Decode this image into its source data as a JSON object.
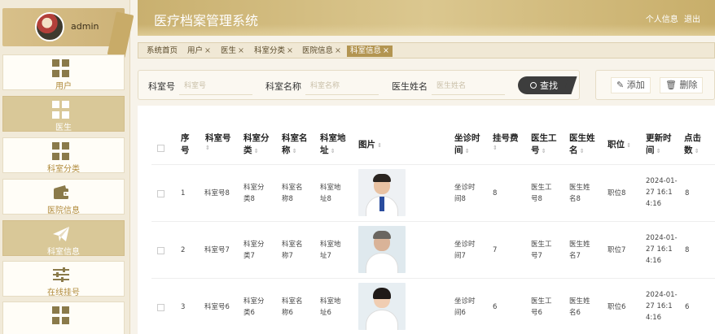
{
  "user": {
    "name": "admin"
  },
  "sidebar": {
    "items": [
      {
        "label": "用户",
        "icon": "grid-icon"
      },
      {
        "label": "医生",
        "icon": "grid-icon"
      },
      {
        "label": "科室分类",
        "icon": "grid-icon"
      },
      {
        "label": "医院信息",
        "icon": "wallet-icon"
      },
      {
        "label": "科室信息",
        "icon": "paper-plane-icon"
      },
      {
        "label": "在线挂号",
        "icon": "sliders-icon"
      },
      {
        "label": "",
        "icon": "grid-icon"
      }
    ]
  },
  "header": {
    "title": "医疗档案管理系统",
    "profile_link": "个人信息",
    "logout_link": "退出"
  },
  "tabs": [
    {
      "label": "系统首页",
      "closable": false
    },
    {
      "label": "用户",
      "closable": true
    },
    {
      "label": "医生",
      "closable": true
    },
    {
      "label": "科室分类",
      "closable": true
    },
    {
      "label": "医院信息",
      "closable": true
    },
    {
      "label": "科室信息",
      "closable": true,
      "active": true
    }
  ],
  "search": {
    "dept_no_label": "科室号",
    "dept_no_placeholder": "科室号",
    "dept_name_label": "科室名称",
    "dept_name_placeholder": "科室名称",
    "doctor_name_label": "医生姓名",
    "doctor_name_placeholder": "医生姓名",
    "button": "查找"
  },
  "actions": {
    "add": "添加",
    "delete": "删除"
  },
  "table": {
    "headers": {
      "index": [
        "序",
        "号"
      ],
      "dept_no": [
        "科室号"
      ],
      "category": [
        "科室分",
        "类"
      ],
      "dept_name": [
        "科室名",
        "称"
      ],
      "address": [
        "科室地",
        "址"
      ],
      "image": [
        "图片"
      ],
      "sit_time": [
        "坐诊时",
        "间"
      ],
      "fee": [
        "挂号费"
      ],
      "doctor_no": [
        "医生工",
        "号"
      ],
      "doctor_name": [
        "医生姓",
        "名"
      ],
      "position": [
        "职位"
      ],
      "updated": [
        "更新时",
        "间"
      ],
      "clicks": [
        "点击",
        "数"
      ]
    },
    "rows": [
      {
        "index": "1",
        "dept_no": "科室号8",
        "category": [
          "科室分",
          "类8"
        ],
        "dept_name": [
          "科室名",
          "称8"
        ],
        "address": [
          "科室地",
          "址8"
        ],
        "sit_time": [
          "坐诊时",
          "间8"
        ],
        "fee": "8",
        "doctor_no": [
          "医生工",
          "号8"
        ],
        "doctor_name": [
          "医生姓",
          "名8"
        ],
        "position": "职位8",
        "updated": [
          "2024-01-",
          "27 16:1",
          "4:16"
        ],
        "clicks": "8"
      },
      {
        "index": "2",
        "dept_no": "科室号7",
        "category": [
          "科室分",
          "类7"
        ],
        "dept_name": [
          "科室名",
          "称7"
        ],
        "address": [
          "科室地",
          "址7"
        ],
        "sit_time": [
          "坐诊时",
          "间7"
        ],
        "fee": "7",
        "doctor_no": [
          "医生工",
          "号7"
        ],
        "doctor_name": [
          "医生姓",
          "名7"
        ],
        "position": "职位7",
        "updated": [
          "2024-01-",
          "27 16:1",
          "4:16"
        ],
        "clicks": "8"
      },
      {
        "index": "3",
        "dept_no": "科室号6",
        "category": [
          "科室分",
          "类6"
        ],
        "dept_name": [
          "科室名",
          "称6"
        ],
        "address": [
          "科室地",
          "址6"
        ],
        "sit_time": [
          "坐诊时",
          "间6"
        ],
        "fee": "6",
        "doctor_no": [
          "医生工",
          "号6"
        ],
        "doctor_name": [
          "医生姓",
          "名6"
        ],
        "position": "职位6",
        "updated": [
          "2024-01-",
          "27 16:1",
          "4:16"
        ],
        "clicks": "6"
      }
    ]
  },
  "colors": {
    "accent": "#b39551",
    "header_gold": "#d4bd82",
    "nav_active": "#d9c898",
    "search_button": "#3d3d3d"
  }
}
